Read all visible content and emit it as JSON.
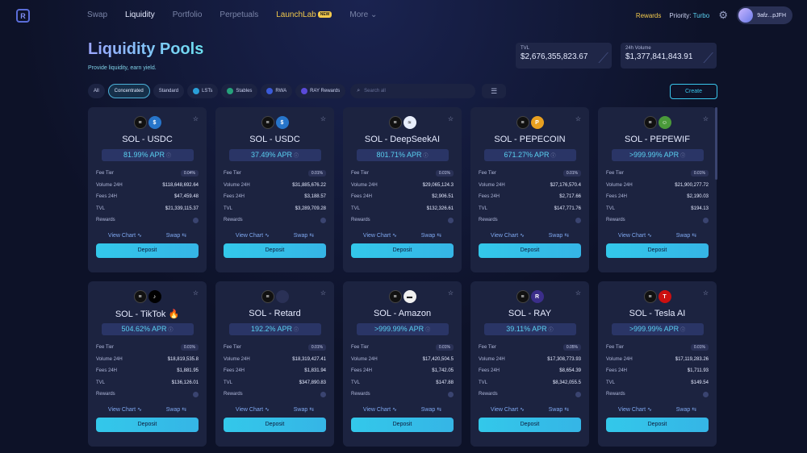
{
  "nav": {
    "links": [
      "Swap",
      "Liquidity",
      "Portfolio",
      "Perpetuals",
      "LaunchLab",
      "More"
    ],
    "new_badge": "NEW",
    "rewards": "Rewards",
    "priority_label": "Priority:",
    "priority_value": "Turbo",
    "wallet": "9afz...pJFH"
  },
  "header": {
    "title": "Liquidity Pools",
    "subtitle": "Provide liquidity, earn yield.",
    "tvl_label": "TVL",
    "tvl_value": "$2,676,355,823.67",
    "volume_label": "24h Volume",
    "volume_value": "$1,377,841,843.91"
  },
  "filters": {
    "chips": [
      "All",
      "Concentrated",
      "Standard",
      "LSTs",
      "Stables",
      "RWA",
      "RAY Rewards"
    ],
    "search_placeholder": "Search all",
    "create_label": "Create"
  },
  "card_labels": {
    "fee_tier": "Fee Tier",
    "volume": "Volume 24H",
    "fees": "Fees 24H",
    "tvl": "TVL",
    "rewards": "Rewards",
    "view_chart": "View Chart",
    "swap": "Swap",
    "deposit": "Deposit"
  },
  "pools": [
    {
      "pair": "SOL - USDC",
      "apr": "81.99% APR",
      "fee": "0.04%",
      "volume": "$118,648,692.64",
      "fees": "$47,459.48",
      "tvl": "$21,339,115.37",
      "token_color": "#2775ca",
      "token_glyph": "$"
    },
    {
      "pair": "SOL - USDC",
      "apr": "37.49% APR",
      "fee": "0.01%",
      "volume": "$31,885,676.22",
      "fees": "$3,188.57",
      "tvl": "$3,289,709.28",
      "token_color": "#2775ca",
      "token_glyph": "$"
    },
    {
      "pair": "SOL - DeepSeekAI",
      "apr": "801.71% APR",
      "fee": "0.01%",
      "volume": "$29,065,124.3",
      "fees": "$2,906.51",
      "tvl": "$132,326.61",
      "token_color": "#e8eefc",
      "token_glyph": "≈"
    },
    {
      "pair": "SOL - PEPECOIN",
      "apr": "671.27% APR",
      "fee": "0.01%",
      "volume": "$27,176,570.4",
      "fees": "$2,717.66",
      "tvl": "$147,771.76",
      "token_color": "#e8a020",
      "token_glyph": "P"
    },
    {
      "pair": "SOL - PEPEWIF",
      "apr": ">999.99% APR",
      "fee": "0.01%",
      "volume": "$21,900,277.72",
      "fees": "$2,190.03",
      "tvl": "$194.13",
      "token_color": "#4a9a3a",
      "token_glyph": "☺"
    },
    {
      "pair": "SOL - TikTok",
      "apr": "504.62% APR",
      "fee": "0.01%",
      "volume": "$18,819,535.8",
      "fees": "$1,881.95",
      "tvl": "$136,126.01",
      "token_color": "#000000",
      "token_glyph": "♪",
      "extra": "🔥"
    },
    {
      "pair": "SOL - Retard",
      "apr": "192.2% APR",
      "fee": "0.01%",
      "volume": "$18,319,427.41",
      "fees": "$1,831.94",
      "tvl": "$347,890.83",
      "token_color": "#2a3156",
      "token_glyph": ""
    },
    {
      "pair": "SOL - Amazon",
      "apr": ">999.99% APR",
      "fee": "0.01%",
      "volume": "$17,420,504.5",
      "fees": "$1,742.05",
      "tvl": "$147.88",
      "token_color": "#f0f0f0",
      "token_glyph": "▬"
    },
    {
      "pair": "SOL - RAY",
      "apr": "39.11% APR",
      "fee": "0.05%",
      "volume": "$17,308,773.93",
      "fees": "$8,654.39",
      "tvl": "$8,342,055.5",
      "token_color": "#3b2e8a",
      "token_glyph": "R"
    },
    {
      "pair": "SOL - Tesla AI",
      "apr": ">999.99% APR",
      "fee": "0.01%",
      "volume": "$17,119,283.26",
      "fees": "$1,711.93",
      "tvl": "$149.54",
      "token_color": "#cc1010",
      "token_glyph": "T"
    }
  ]
}
